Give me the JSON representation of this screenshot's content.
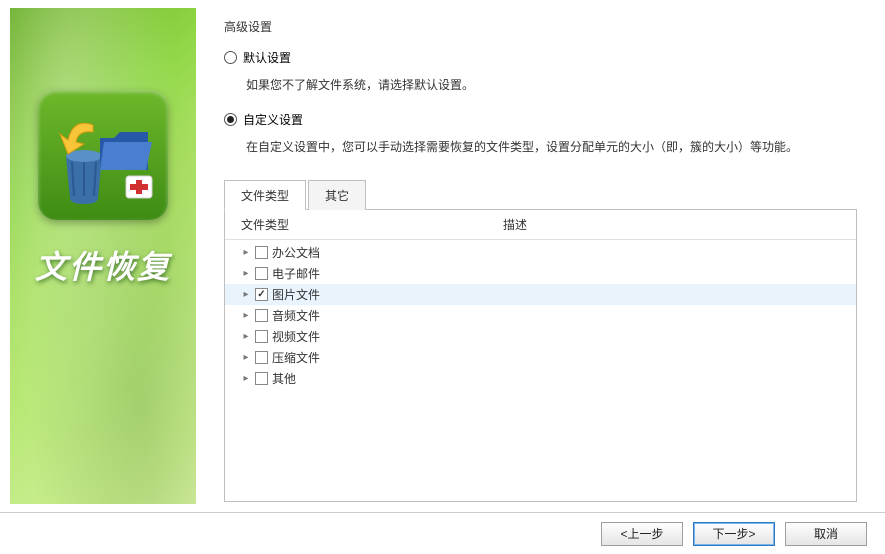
{
  "sidebar": {
    "title": "文件恢复"
  },
  "content": {
    "heading": "高级设置",
    "options": {
      "default": {
        "label": "默认设置",
        "desc": "如果您不了解文件系统，请选择默认设置。",
        "checked": false
      },
      "custom": {
        "label": "自定义设置",
        "desc": "在自定义设置中，您可以手动选择需要恢复的文件类型，设置分配单元的大小（即，簇的大小）等功能。",
        "checked": true
      }
    },
    "tabs": [
      {
        "label": "文件类型",
        "active": true
      },
      {
        "label": "其它",
        "active": false
      }
    ],
    "tree": {
      "columns": {
        "type": "文件类型",
        "desc": "描述"
      },
      "items": [
        {
          "label": "办公文档",
          "checked": false,
          "selected": false
        },
        {
          "label": "电子邮件",
          "checked": false,
          "selected": false
        },
        {
          "label": "图片文件",
          "checked": true,
          "selected": true
        },
        {
          "label": "音频文件",
          "checked": false,
          "selected": false
        },
        {
          "label": "视频文件",
          "checked": false,
          "selected": false
        },
        {
          "label": "压缩文件",
          "checked": false,
          "selected": false
        },
        {
          "label": "其他",
          "checked": false,
          "selected": false
        }
      ]
    }
  },
  "footer": {
    "back": "<上一步",
    "next": "下一步>",
    "cancel": "取消"
  }
}
